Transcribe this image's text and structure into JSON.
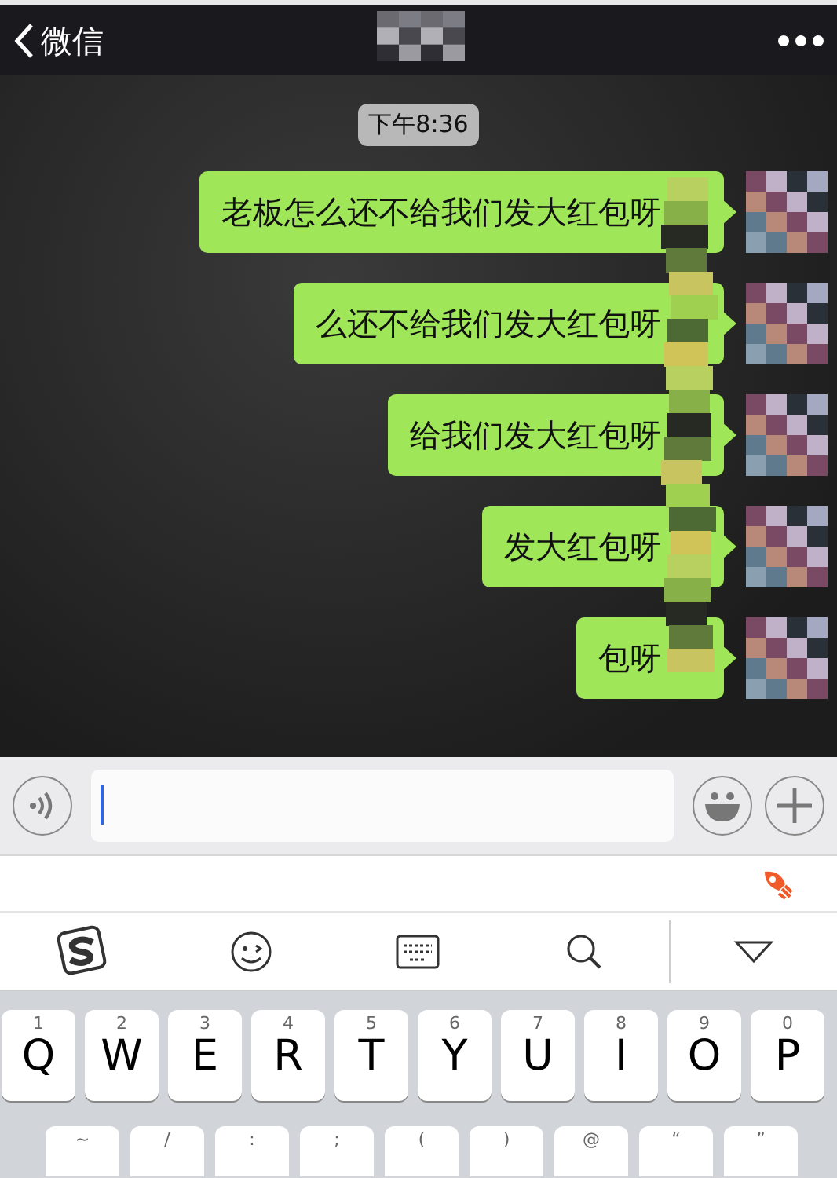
{
  "nav": {
    "back_label": "微信"
  },
  "timestamp": "下午8:36",
  "messages": [
    {
      "text": "老板怎么还不给我们发大红包呀"
    },
    {
      "text": "么还不给我们发大红包呀"
    },
    {
      "text": "给我们发大红包呀"
    },
    {
      "text": "发大红包呀"
    },
    {
      "text": "包呀"
    }
  ],
  "keyboard": {
    "row1": [
      {
        "hint": "1",
        "letter": "Q"
      },
      {
        "hint": "2",
        "letter": "W"
      },
      {
        "hint": "3",
        "letter": "E"
      },
      {
        "hint": "4",
        "letter": "R"
      },
      {
        "hint": "5",
        "letter": "T"
      },
      {
        "hint": "6",
        "letter": "Y"
      },
      {
        "hint": "7",
        "letter": "U"
      },
      {
        "hint": "8",
        "letter": "I"
      },
      {
        "hint": "9",
        "letter": "O"
      },
      {
        "hint": "0",
        "letter": "P"
      }
    ],
    "row2": [
      {
        "hint": "~"
      },
      {
        "hint": "/"
      },
      {
        "hint": ":"
      },
      {
        "hint": ";"
      },
      {
        "hint": "("
      },
      {
        "hint": ")"
      },
      {
        "hint": "@"
      },
      {
        "hint": "“"
      },
      {
        "hint": "”"
      }
    ]
  }
}
